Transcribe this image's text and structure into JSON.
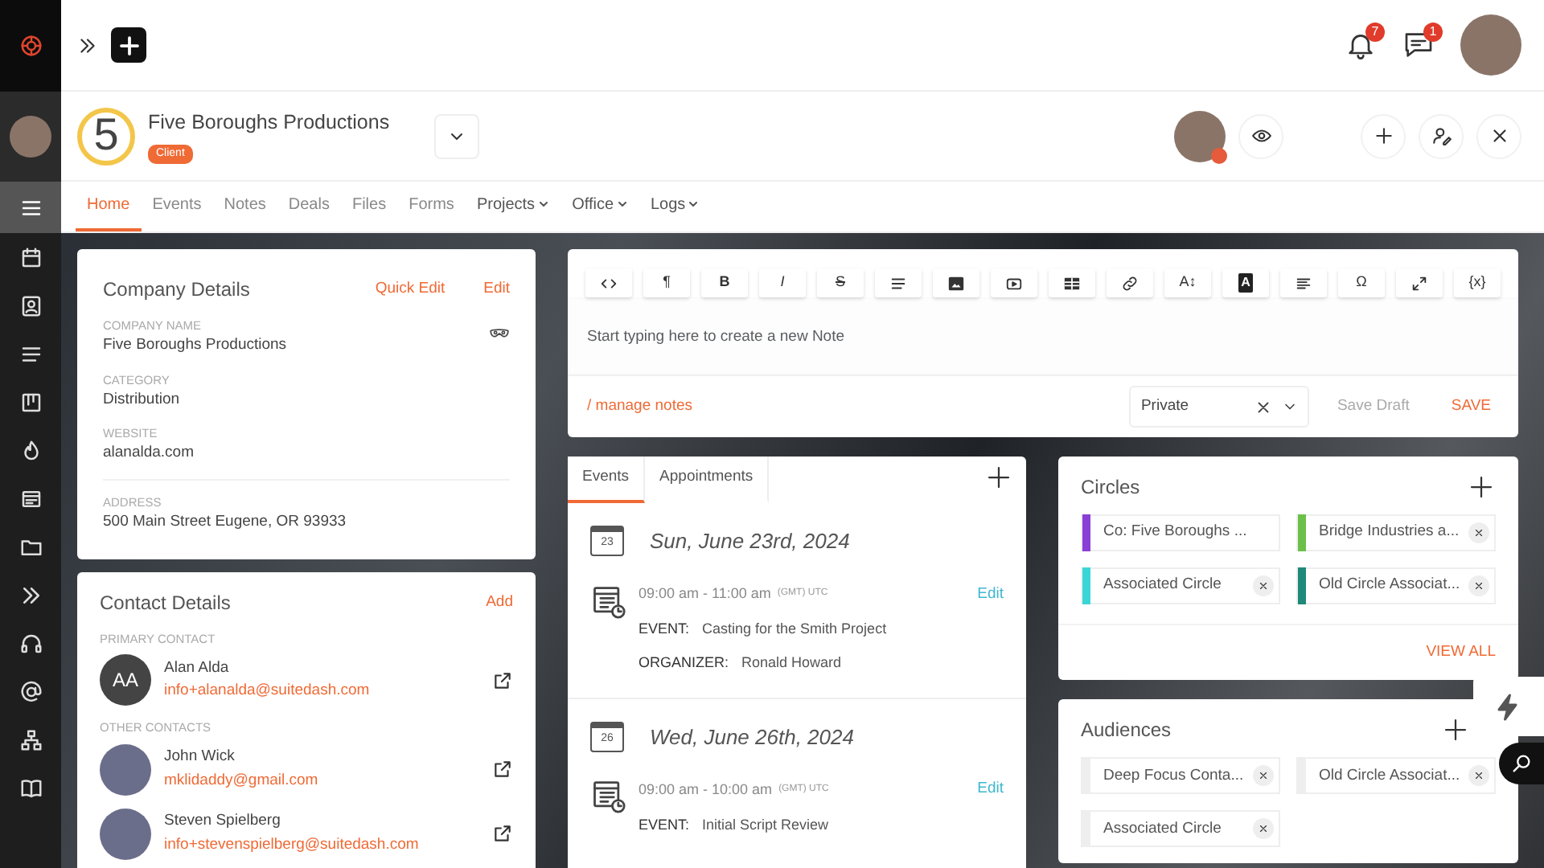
{
  "sidebar": {
    "items": [
      {
        "kind": "logo",
        "selected": false
      },
      {
        "kind": "avatar",
        "selected": false
      },
      {
        "kind": "menu",
        "selected": true
      },
      {
        "kind": "calendar",
        "selected": false
      },
      {
        "kind": "contact",
        "selected": false
      },
      {
        "kind": "list",
        "selected": false
      },
      {
        "kind": "board",
        "selected": false
      },
      {
        "kind": "fire",
        "selected": false
      },
      {
        "kind": "window",
        "selected": false
      },
      {
        "kind": "folder",
        "selected": false
      },
      {
        "kind": "chevrons",
        "selected": false
      },
      {
        "kind": "headset",
        "selected": false
      },
      {
        "kind": "at",
        "selected": false
      },
      {
        "kind": "sitemap",
        "selected": false
      },
      {
        "kind": "book",
        "selected": false
      }
    ]
  },
  "topbar": {
    "notifications": "7",
    "messages": "1"
  },
  "header": {
    "logo_text": "5",
    "company": "Five Boroughs Productions",
    "tag": "Client"
  },
  "tabs": [
    {
      "label": "Home",
      "selected": true,
      "menu": false
    },
    {
      "label": "Events",
      "selected": false,
      "menu": false
    },
    {
      "label": "Notes",
      "selected": false,
      "menu": false
    },
    {
      "label": "Deals",
      "selected": false,
      "menu": false
    },
    {
      "label": "Files",
      "selected": false,
      "menu": false
    },
    {
      "label": "Forms",
      "selected": false,
      "menu": false
    },
    {
      "label": "Projects",
      "selected": false,
      "menu": true
    },
    {
      "label": "Office",
      "selected": false,
      "menu": true
    },
    {
      "label": "Logs",
      "selected": false,
      "menu": true
    }
  ],
  "company_details": {
    "title": "Company Details",
    "actions": [
      "Quick Edit",
      "Edit"
    ],
    "sections": [
      [
        {
          "label": "COMPANY NAME",
          "value": "Five Boroughs Productions"
        },
        {
          "label": "CATEGORY",
          "value": "Distribution"
        },
        {
          "label": "WEBSITE",
          "value": "alanalda.com"
        }
      ],
      [
        {
          "label": "ADDRESS",
          "value": "500 Main Street Eugene, OR 93933"
        }
      ]
    ]
  },
  "contact_details": {
    "title": "Contact Details",
    "action": "Add",
    "groups": [
      {
        "heading": "PRIMARY CONTACT",
        "contacts": [
          {
            "name": "Alan Alda",
            "email": "info+alanalda@suitedash.com",
            "kind": "initials",
            "initials": "AA"
          }
        ]
      },
      {
        "heading": "OTHER CONTACTS",
        "contacts": [
          {
            "name": "John Wick",
            "email": "mklidaddy@gmail.com",
            "kind": "photo"
          },
          {
            "name": "Steven Spielberg",
            "email": "info+stevenspielberg@suitedash.com",
            "kind": "photo"
          }
        ]
      }
    ]
  },
  "editor": {
    "toolbar": [
      {
        "kind": "code"
      },
      {
        "kind": "glyph",
        "glyph": "¶"
      },
      {
        "kind": "bold",
        "glyph": "B"
      },
      {
        "kind": "italic",
        "glyph": "I"
      },
      {
        "kind": "strike",
        "glyph": "S"
      },
      {
        "kind": "list"
      },
      {
        "kind": "image"
      },
      {
        "kind": "video"
      },
      {
        "kind": "table"
      },
      {
        "kind": "link"
      },
      {
        "kind": "glyph",
        "glyph": "A↕"
      },
      {
        "kind": "boxed",
        "glyph": "A"
      },
      {
        "kind": "align"
      },
      {
        "kind": "glyph",
        "glyph": "Ω"
      },
      {
        "kind": "expand"
      },
      {
        "kind": "glyph",
        "glyph": "{x}"
      }
    ],
    "placeholder": "Start typing here to create a new Note",
    "manage": "/ manage notes",
    "visibility": "Private",
    "save_draft": "Save Draft",
    "save": "SAVE"
  },
  "events": {
    "tabs": [
      {
        "label": "Events",
        "selected": true
      },
      {
        "label": "Appointments",
        "selected": false
      }
    ],
    "days": [
      {
        "date": "Sun, June 23rd, 2024",
        "day": "23",
        "entries": [
          {
            "time": "09:00 am - 11:00 am",
            "tz": "(GMT) UTC",
            "edit": "Edit",
            "fields": [
              {
                "label": "EVENT:",
                "value": "Casting for the Smith Project"
              },
              {
                "label": "ORGANIZER:",
                "value": "Ronald Howard"
              }
            ]
          }
        ]
      },
      {
        "date": "Wed, June 26th, 2024",
        "day": "26",
        "entries": [
          {
            "time": "09:00 am - 10:00 am",
            "tz": "(GMT) UTC",
            "edit": "Edit",
            "fields": [
              {
                "label": "EVENT:",
                "value": "Initial Script Review"
              }
            ]
          }
        ]
      }
    ]
  },
  "circles": {
    "title": "Circles",
    "chips": [
      {
        "label": "Co: Five Boroughs ...",
        "color": "#8a3fd6",
        "removable": false
      },
      {
        "label": "Bridge Industries a...",
        "color": "#6cc04a",
        "removable": true
      },
      {
        "label": "Associated Circle",
        "color": "#3ad6d6",
        "removable": true
      },
      {
        "label": "Old Circle Associat...",
        "color": "#1f8a7a",
        "removable": true
      }
    ],
    "footer": "VIEW ALL"
  },
  "audiences": {
    "title": "Audiences",
    "chips": [
      {
        "label": "Deep Focus Conta...",
        "removable": true
      },
      {
        "label": "Old Circle Associat...",
        "removable": true
      },
      {
        "label": "Associated Circle",
        "removable": true
      }
    ]
  }
}
